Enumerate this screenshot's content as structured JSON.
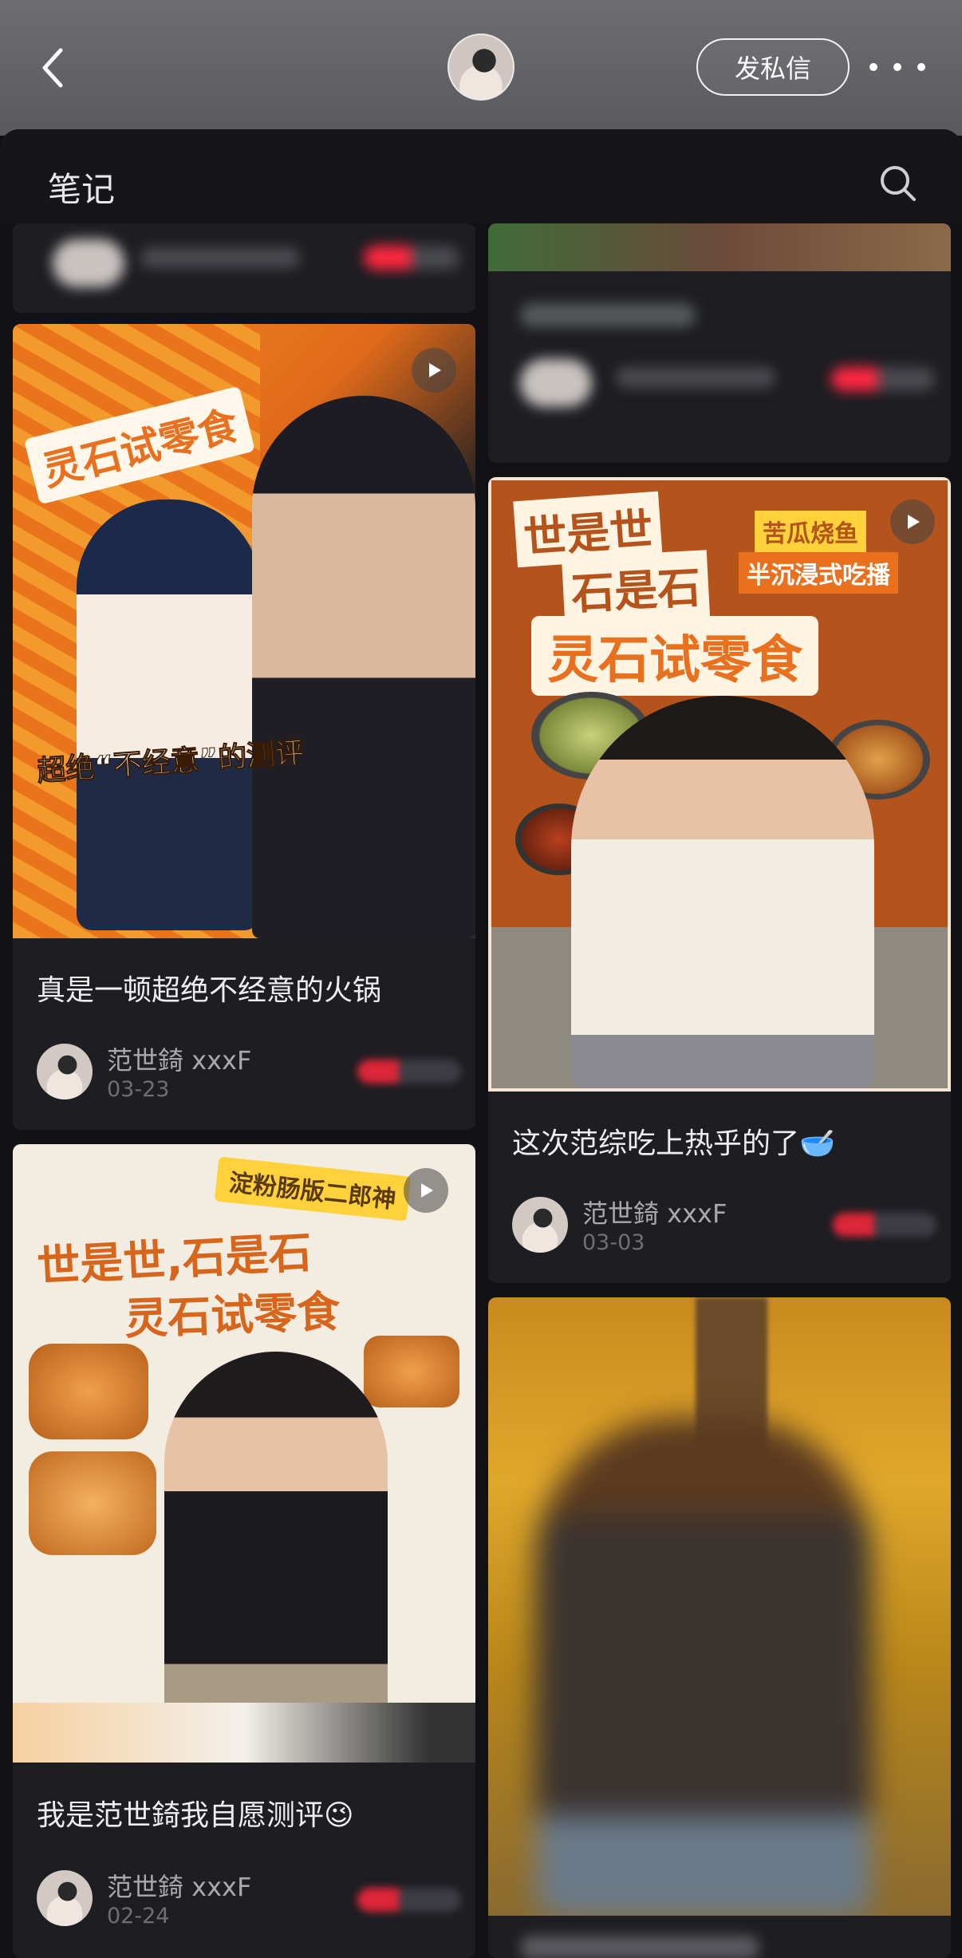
{
  "header": {
    "back_icon": "chevron-left-icon",
    "dm_label": "发私信",
    "more_icon": "ellipsis-icon"
  },
  "sheet": {
    "title": "笔记",
    "search_icon": "search-icon"
  },
  "cards": [
    {
      "title": "真是一顿超绝不经意的火锅",
      "author": "范世錡 xxxF",
      "date": "03-23",
      "has_video": true,
      "overlay": {
        "badge": "灵石试零食",
        "caption": "超绝“不经意”的测评"
      }
    },
    {
      "title": "这次范综吃上热乎的了🥣",
      "author": "范世錡 xxxF",
      "date": "03-03",
      "has_video": true,
      "overlay": {
        "line1": "世是世",
        "line2": "石是石",
        "tag1": "苦瓜烧鱼",
        "tag2": "半沉浸式吃播",
        "main": "灵石试零食"
      }
    },
    {
      "title": "我是范世錡我自愿测评😉",
      "author": "范世錡 xxxF",
      "date": "02-24",
      "has_video": true,
      "overlay": {
        "banner": "淀粉肠版二郎神",
        "line1": "世是世,石是石",
        "line2": "灵石试零食"
      }
    },
    {
      "title": "",
      "author": "",
      "date": "",
      "has_video": false
    }
  ],
  "colors": {
    "background": "#121216",
    "card": "#1d1d22",
    "accent_orange": "#e8701e",
    "like_red": "#ff2840"
  }
}
